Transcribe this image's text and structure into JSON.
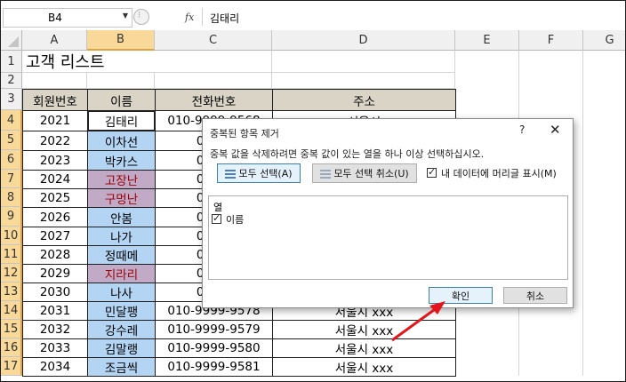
{
  "formula_bar": {
    "name_box": "B4",
    "fx_label": "fx",
    "formula_value": "김태리"
  },
  "columns": [
    "A",
    "B",
    "C",
    "D",
    "E",
    "F",
    "G"
  ],
  "rows": [
    "1",
    "2",
    "3",
    "4",
    "5",
    "6",
    "7",
    "8",
    "9",
    "10",
    "11",
    "12",
    "13",
    "14",
    "15",
    "16",
    "17"
  ],
  "sheet": {
    "title": "고객 리스트",
    "headers": {
      "id": "회원번호",
      "name": "이름",
      "phone": "전화번호",
      "address": "주소"
    },
    "data_rows": [
      {
        "id": "2021",
        "name": "김태리",
        "phone": "010-9999-9568",
        "address": "서울시"
      },
      {
        "id": "2022",
        "name": "이차선",
        "phone": "010-9",
        "address": ""
      },
      {
        "id": "2023",
        "name": "박카스",
        "phone": "010-9",
        "address": ""
      },
      {
        "id": "2024",
        "name": "고장난",
        "phone": "010-9",
        "address": ""
      },
      {
        "id": "2025",
        "name": "구멍난",
        "phone": "010-9",
        "address": ""
      },
      {
        "id": "2026",
        "name": "안봄",
        "phone": "010-9",
        "address": ""
      },
      {
        "id": "2027",
        "name": "나가",
        "phone": "010-9",
        "address": ""
      },
      {
        "id": "2028",
        "name": "정때메",
        "phone": "010-9",
        "address": ""
      },
      {
        "id": "2029",
        "name": "지라리",
        "phone": "010-9",
        "address": ""
      },
      {
        "id": "2030",
        "name": "나사",
        "phone": "010-9",
        "address": ""
      },
      {
        "id": "2031",
        "name": "민달팽",
        "phone": "010-9999-9578",
        "address": "서울시 xxx"
      },
      {
        "id": "2032",
        "name": "강수레",
        "phone": "010-9999-9579",
        "address": "서울시 xxx"
      },
      {
        "id": "2033",
        "name": "김말랭",
        "phone": "010-9999-9580",
        "address": "서울시 xxx"
      },
      {
        "id": "2034",
        "name": "조금씩",
        "phone": "010-9999-9581",
        "address": "서울시 xxx"
      }
    ]
  },
  "dialog": {
    "title": "중복된 항목 제거",
    "help": "?",
    "close": "✕",
    "instruction": "중복 값을 삭제하려면 중복 값이 있는 열을 하나 이상 선택하십시오.",
    "select_all": "모두 선택(A)",
    "unselect_all": "모두 선택 취소(U)",
    "has_headers_label": "내 데이터에 머리글 표시(M)",
    "has_headers_checked": true,
    "columns_header": "열",
    "column_items": [
      {
        "label": "이름",
        "checked": true
      }
    ],
    "ok": "확인",
    "cancel": "취소"
  },
  "colors": {
    "header_fill": "#d9d4c5",
    "unique_fill": "#b4d4f3",
    "duplicate_fill": "#c0aac6",
    "duplicate_text": "#9c0006",
    "selected_header": "#f9d99a",
    "annotation_arrow": "#e3161e"
  }
}
